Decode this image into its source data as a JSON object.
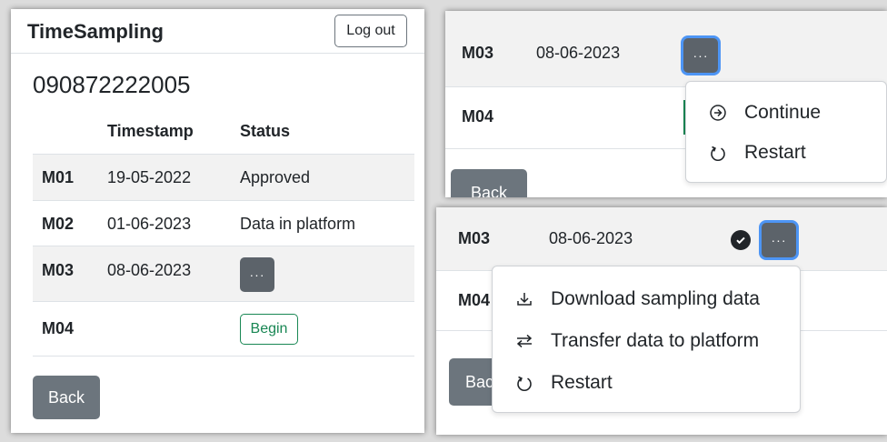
{
  "app": {
    "title": "TimeSampling",
    "logout_label": "Log out"
  },
  "phone_number": "090872222005",
  "table": {
    "headers": [
      "",
      "Timestamp",
      "Status"
    ],
    "rows": [
      {
        "id": "M01",
        "timestamp": "19-05-2022",
        "status": "Approved"
      },
      {
        "id": "M02",
        "timestamp": "01-06-2023",
        "status": "Data in platform"
      },
      {
        "id": "M03",
        "timestamp": "08-06-2023",
        "status": ""
      },
      {
        "id": "M04",
        "timestamp": "",
        "status": ""
      }
    ]
  },
  "actions": {
    "more_label": "···",
    "begin_label": "Begin",
    "back_label": "Back"
  },
  "menu_in_progress": {
    "items": [
      "Continue",
      "Restart"
    ]
  },
  "menu_completed": {
    "items": [
      "Download sampling data",
      "Transfer data to platform",
      "Restart"
    ]
  },
  "colors": {
    "secondary": "#5c636a",
    "success": "#198754",
    "focus": "#4d95f5"
  }
}
